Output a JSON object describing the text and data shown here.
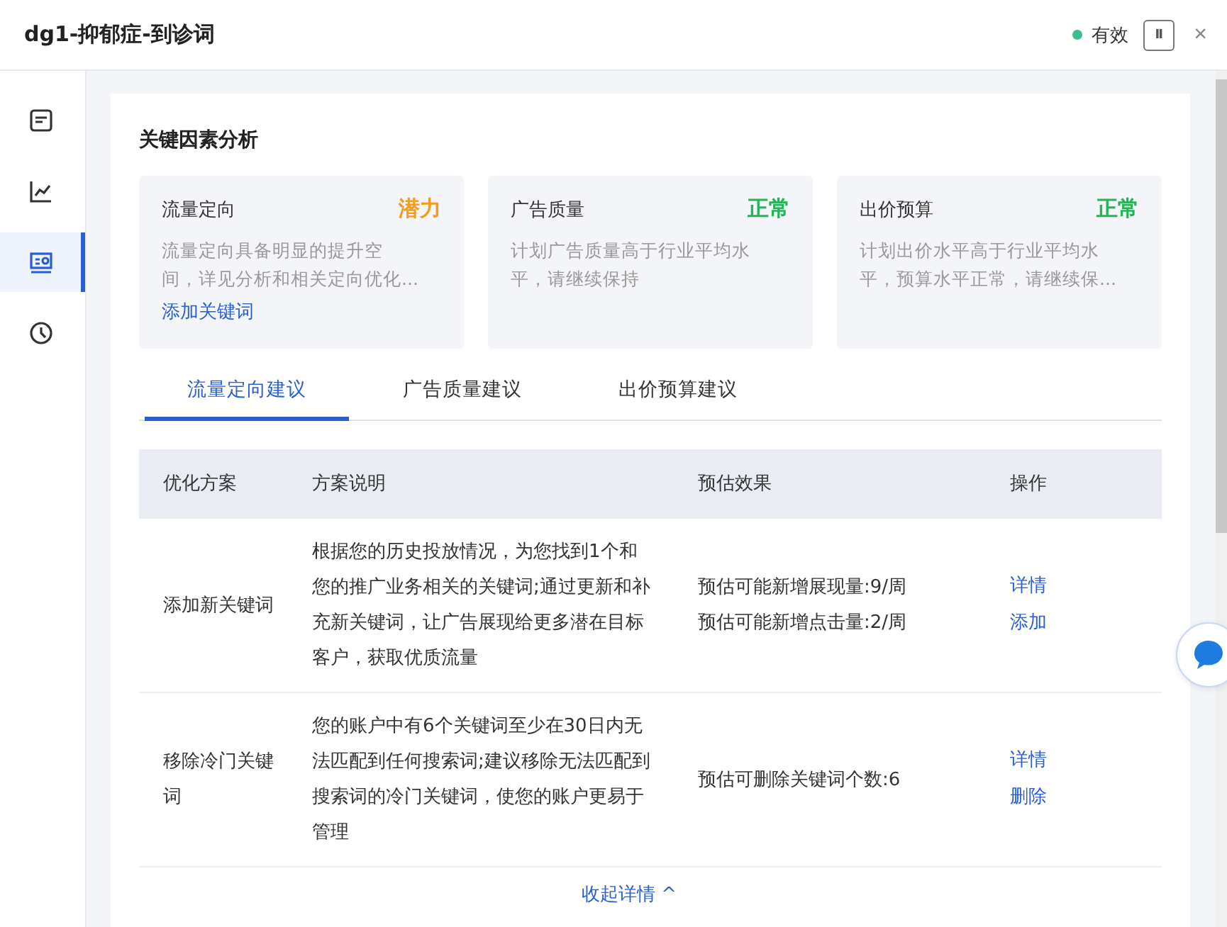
{
  "window": {
    "title": "dg1-抑郁症-到诊词",
    "status": {
      "label": "有效",
      "color": "#3dbf8a"
    },
    "pause_glyph": "II",
    "close_glyph": "×"
  },
  "sidebar": {
    "items": [
      {
        "kind": "note",
        "selected": false
      },
      {
        "kind": "chart",
        "selected": false
      },
      {
        "kind": "report",
        "selected": true
      },
      {
        "kind": "clock",
        "selected": false
      }
    ]
  },
  "section_title": "关键因素分析",
  "factors": [
    {
      "name": "流量定向",
      "status": "潜力",
      "color": "#f39c1f",
      "lines": [
        "流量定向具备明显的提升空",
        "间，详见分析和相关定向优化..."
      ],
      "link": "添加关键词"
    },
    {
      "name": "广告质量",
      "status": "正常",
      "color": "#27b358",
      "lines": [
        "计划广告质量高于行业平均水",
        "平，请继续保持"
      ]
    },
    {
      "name": "出价预算",
      "status": "正常",
      "color": "#27b358",
      "lines": [
        "计划出价水平高于行业平均水",
        "平，预算水平正常，请继续保..."
      ]
    }
  ],
  "tabs": [
    {
      "label": "流量定向建议",
      "selected": true
    },
    {
      "label": "广告质量建议",
      "selected": false
    },
    {
      "label": "出价预算建议",
      "selected": false
    }
  ],
  "table": {
    "columns": [
      "优化方案",
      "方案说明",
      "预估效果",
      "操作"
    ],
    "rows": [
      {
        "plan": [
          "添加新关键词"
        ],
        "desc": [
          "根据您的历史投放情况，为您找到1个和",
          "您的推广业务相关的关键词;通过更新和补",
          "充新关键词，让广告展现给更多潜在目标",
          "客户，获取优质流量"
        ],
        "effect": [
          "预估可能新增展现量:9/周",
          "预估可能新增点击量:2/周"
        ],
        "actions": [
          "详情",
          "添加"
        ]
      },
      {
        "plan": [
          "移除冷门关键",
          "词"
        ],
        "desc": [
          "您的账户中有6个关键词至少在30日内无",
          "法匹配到任何搜索词;建议移除无法匹配到",
          "搜索词的冷门关键词，使您的账户更易于",
          "管理"
        ],
        "effect": [
          "预估可删除关键词个数:6"
        ],
        "actions": [
          "详情",
          "删除"
        ]
      }
    ]
  },
  "collapse_link": "收起详情 ^"
}
